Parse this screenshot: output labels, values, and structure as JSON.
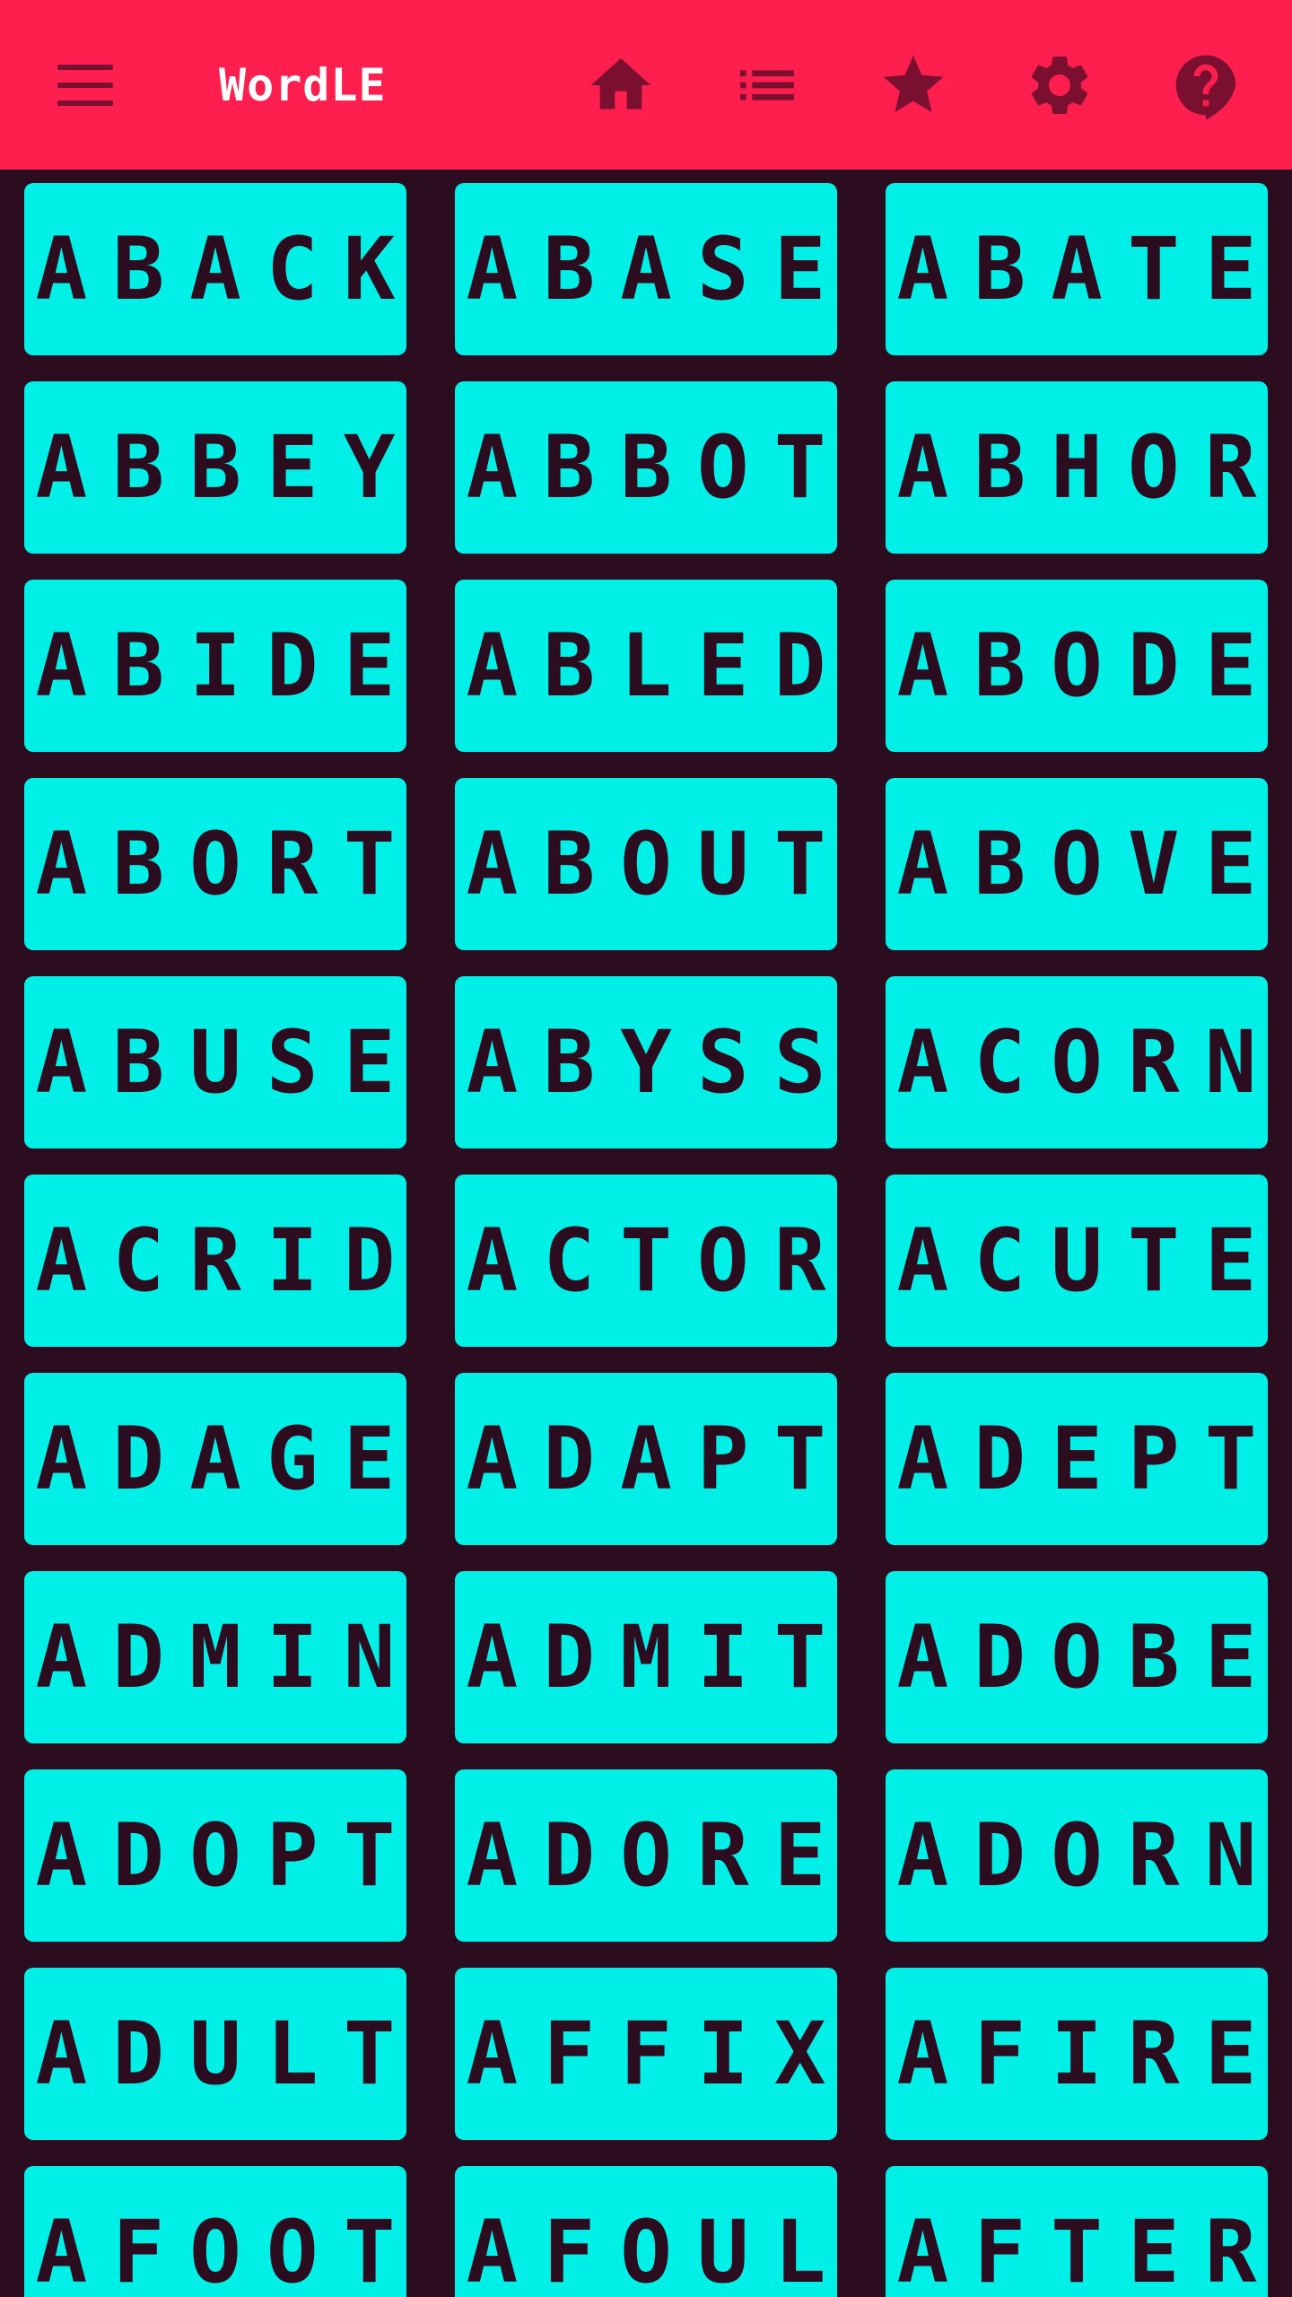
{
  "header": {
    "title": "WordLE",
    "icons": [
      "menu-icon",
      "home-icon",
      "list-icon",
      "star-icon",
      "gear-icon",
      "help-icon"
    ]
  },
  "colors": {
    "header_bg": "#ff1f4f",
    "icon_color": "#7a0f30",
    "page_bg": "#2b0d1f",
    "tile_bg": "#00f0e8",
    "tile_text": "#2b0d1f"
  },
  "words": [
    "ABACK",
    "ABASE",
    "ABATE",
    "ABBEY",
    "ABBOT",
    "ABHOR",
    "ABIDE",
    "ABLED",
    "ABODE",
    "ABORT",
    "ABOUT",
    "ABOVE",
    "ABUSE",
    "ABYSS",
    "ACORN",
    "ACRID",
    "ACTOR",
    "ACUTE",
    "ADAGE",
    "ADAPT",
    "ADEPT",
    "ADMIN",
    "ADMIT",
    "ADOBE",
    "ADOPT",
    "ADORE",
    "ADORN",
    "ADULT",
    "AFFIX",
    "AFIRE",
    "AFOOT",
    "AFOUL",
    "AFTER"
  ]
}
